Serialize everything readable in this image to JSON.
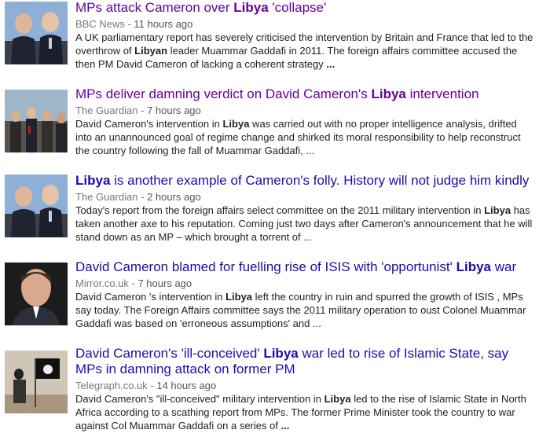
{
  "results": [
    {
      "title_pre": "MPs attack Cameron over ",
      "title_bold": "Libya",
      "title_post": " 'collapse'",
      "source": "BBC News",
      "age": "11 hours ago",
      "snippet_pre": "A UK parliamentary report has severely criticised the intervention by Britain and France that led to the overthrow of ",
      "snippet_bold": "Libyan",
      "snippet_post": " leader Muammar Gaddafi in 2011. The foreign affairs committee accused the then PM David Cameron of lacking a coherent strategy ",
      "ellipsis": "...",
      "visited": true
    },
    {
      "title_pre": "MPs deliver damning verdict on David Cameron's ",
      "title_bold": "Libya",
      "title_post": " intervention",
      "source": "The Guardian",
      "age": "7 hours ago",
      "snippet_pre": "David Cameron's intervention in ",
      "snippet_bold": "Libya",
      "snippet_post": " was carried out with no proper intelligence analysis, drifted into an unannounced goal of regime change and shirked its moral responsibility to help reconstruct the country following the fall of Muammar Gaddafi, ...",
      "ellipsis": "",
      "visited": true
    },
    {
      "title_pre": "",
      "title_bold": "Libya",
      "title_post": " is another example of Cameron's folly. History will not judge him kindly",
      "source": "The Guardian",
      "age": "2 hours ago",
      "snippet_pre": "Today's report from the foreign affairs select committee on the 2011 military intervention in ",
      "snippet_bold": "Libya",
      "snippet_post": " has taken another axe to his reputation. Coming just two days after Cameron's announcement that he will stand down as an MP – which brought a torrent of ...",
      "ellipsis": "",
      "visited": false
    },
    {
      "title_pre": "David Cameron blamed for fuelling rise of ISIS with 'opportunist' ",
      "title_bold": "Libya",
      "title_post": " war",
      "source": "Mirror.co.uk",
      "age": "7 hours ago",
      "snippet_pre": "David Cameron 's intervention in ",
      "snippet_bold": "Libya",
      "snippet_post": " left the country in ruin and spurred the growth of ISIS , MPs say today. The Foreign Affairs committee says the 2011 military operation to oust Colonel Muammar Gaddafi was based on 'erroneous assumptions' and ...",
      "ellipsis": "",
      "visited": false
    },
    {
      "title_pre": "David Cameron's 'ill-conceived' ",
      "title_bold": "Libya",
      "title_post": " war led to rise of Islamic State, say MPs in damning attack on former PM",
      "source": "Telegraph.co.uk",
      "age": "14 hours ago",
      "snippet_pre": "David Cameron's \"ill-conceived\" military intervention in ",
      "snippet_bold": "Libya",
      "snippet_post": " led to the rise of Islamic State in North Africa according to a scathing report from MPs. The former Prime Minister took the country to war against Col Muammar Gaddafi on a series of ",
      "ellipsis": "...",
      "visited": false
    }
  ],
  "meta_separator": " - "
}
